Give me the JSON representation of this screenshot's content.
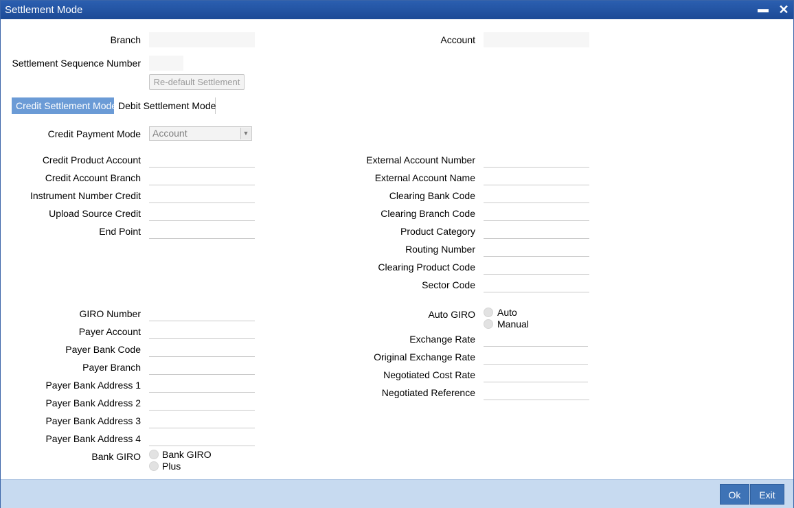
{
  "window": {
    "title": "Settlement Mode",
    "minimize": "▬",
    "close": "✕"
  },
  "header": {
    "branch_label": "Branch",
    "account_label": "Account",
    "seq_label": "Settlement Sequence Number",
    "redefault_button": "Re-default Settlement"
  },
  "tabs": [
    {
      "label": "Credit Settlement Mode",
      "active": true
    },
    {
      "label": "Debit Settlement Mode",
      "active": false
    }
  ],
  "payment_mode": {
    "label": "Credit Payment Mode",
    "value": "Account",
    "arrow": "▼"
  },
  "left_fields": [
    {
      "label": "Credit Product Account"
    },
    {
      "label": "Credit Account Branch"
    },
    {
      "label": "Instrument Number Credit"
    },
    {
      "label": "Upload Source Credit"
    },
    {
      "label": "End Point"
    }
  ],
  "right_fields": [
    {
      "label": "External Account Number"
    },
    {
      "label": "External Account Name"
    },
    {
      "label": "Clearing Bank Code"
    },
    {
      "label": "Clearing Branch Code"
    },
    {
      "label": "Product Category"
    },
    {
      "label": "Routing Number"
    },
    {
      "label": "Clearing Product Code"
    },
    {
      "label": "Sector Code"
    }
  ],
  "giro_fields": [
    {
      "label": "GIRO Number"
    },
    {
      "label": "Payer Account"
    },
    {
      "label": "Payer Bank Code"
    },
    {
      "label": "Payer Branch"
    },
    {
      "label": "Payer Bank Address 1"
    },
    {
      "label": "Payer Bank Address 2"
    },
    {
      "label": "Payer Bank Address 3"
    },
    {
      "label": "Payer Bank Address 4"
    }
  ],
  "bank_giro": {
    "label": "Bank GIRO",
    "options": [
      "Bank GIRO",
      "Plus"
    ]
  },
  "auto_giro": {
    "label": "Auto GIRO",
    "options": [
      "Auto",
      "Manual"
    ]
  },
  "rate_fields": [
    {
      "label": "Exchange Rate"
    },
    {
      "label": "Original Exchange Rate"
    },
    {
      "label": "Negotiated Cost Rate"
    },
    {
      "label": "Negotiated Reference"
    }
  ],
  "footer": {
    "ok": "Ok",
    "exit": "Exit"
  }
}
